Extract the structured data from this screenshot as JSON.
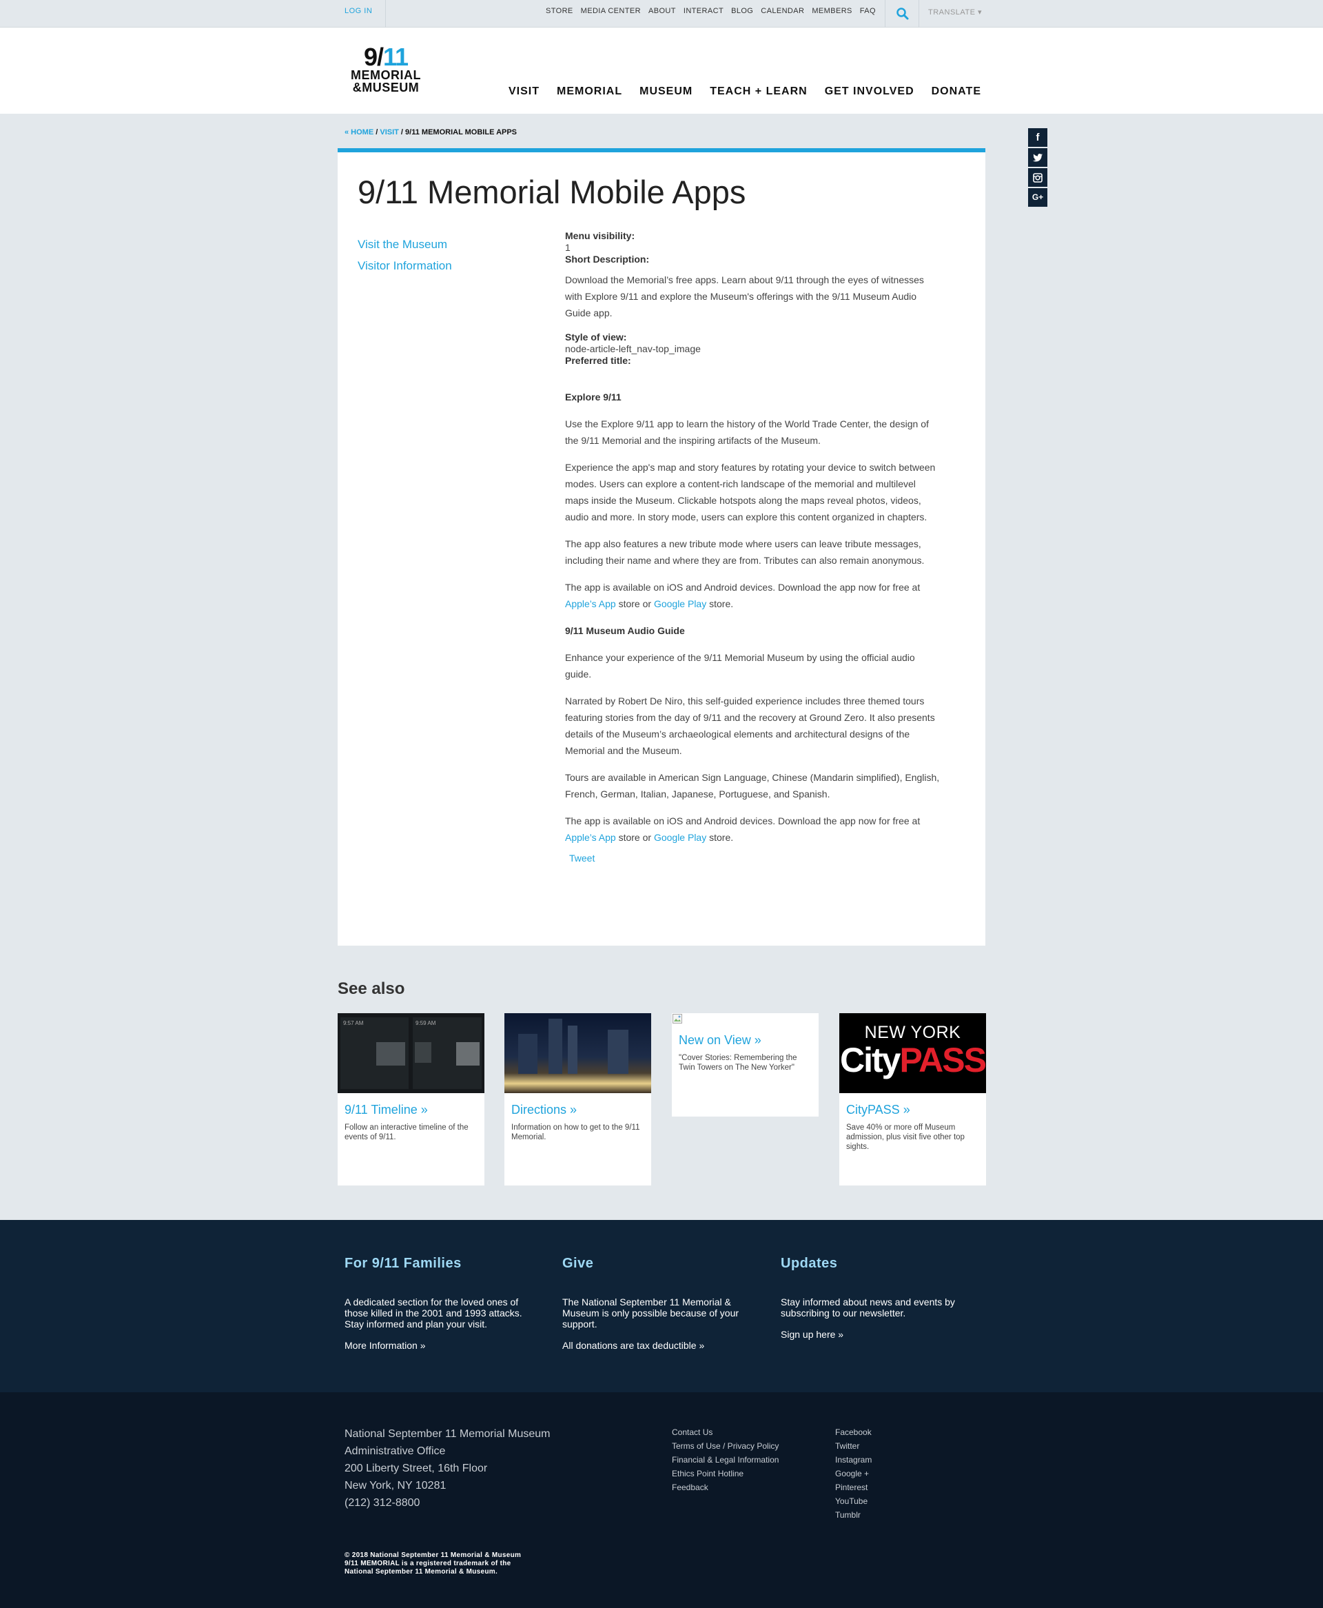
{
  "util": {
    "login": "LOG IN",
    "links": [
      "STORE",
      "MEDIA CENTER",
      "ABOUT",
      "INTERACT",
      "BLOG",
      "CALENDAR",
      "MEMBERS",
      "FAQ"
    ],
    "translate": "TRANSLATE ▾"
  },
  "logo": {
    "line1a": "9/",
    "line1b": "11",
    "line2": "MEMORIAL",
    "line3": "&MUSEUM"
  },
  "nav": [
    "VISIT",
    "MEMORIAL",
    "MUSEUM",
    "TEACH + LEARN",
    "GET INVOLVED",
    "DONATE"
  ],
  "breadcrumb": {
    "home": "« HOME",
    "visit": "VISIT",
    "current": "9/11 MEMORIAL MOBILE APPS",
    "sep": " / "
  },
  "social": [
    "f",
    "t",
    "i",
    "G+"
  ],
  "page": {
    "title": "9/11 Memorial Mobile Apps",
    "leftnav": [
      "Visit the Museum",
      "Visitor Information"
    ],
    "menu_visibility_label": "Menu visibility:",
    "menu_visibility_value": "1",
    "short_desc_label": "Short Description:",
    "short_desc": "Download the Memorial’s free apps. Learn about 9/11 through the eyes of witnesses with Explore 9/11 and explore the Museum's offerings with the 9/11 Museum Audio Guide app.",
    "style_label": "Style of view:",
    "style_value": "node-article-left_nav-top_image",
    "preferred_label": "Preferred title:",
    "explore_heading": "Explore 9/11",
    "p1": "Use the Explore 9/11 app to learn the history of the World Trade Center, the design of the 9/11 Memorial and the inspiring artifacts of the Museum.",
    "p2": "Experience the app's map and story features by rotating your device to switch between modes. Users can explore a content-rich landscape of the memorial and multilevel maps inside the Museum. Clickable hotspots along the maps reveal photos, videos, audio and more. In story mode, users can explore this content organized in chapters.",
    "p3": "The app also features a new tribute mode where users can leave tribute messages, including their name and where they are from. Tributes can also remain anonymous.",
    "avail_pre": "The app is available on iOS and Android devices. Download the app now for free at ",
    "apple": "Apple’s App",
    "mid": " store or ",
    "google": "Google Play",
    "post": " store.",
    "audio_heading": "9/11 Museum Audio Guide",
    "p4": "Enhance your experience of the 9/11 Memorial Museum by using the official audio guide.",
    "p5": "Narrated by Robert De Niro, this self-guided experience includes three themed tours featuring stories from the day of 9/11 and the recovery at Ground Zero. It also presents details of the Museum’s archaeological elements and architectural designs of the Memorial and the Museum.",
    "p6": "Tours are available in American Sign Language, Chinese (Mandarin simplified), English, French, German, Italian, Japanese, Portuguese, and Spanish.",
    "tweet": "Tweet"
  },
  "seealso": {
    "title": "See also",
    "tiles": [
      {
        "title": "9/11 Timeline »",
        "desc": "Follow an interactive timeline of the events of 9/11."
      },
      {
        "title": "Directions »",
        "desc": "Information on how to get to the 9/11 Memorial."
      },
      {
        "title": "New on View »",
        "desc": "\"Cover Stories: Remembering the Twin Towers on The New Yorker\""
      },
      {
        "title": "CityPASS »",
        "desc": "Save 40% or more off Museum admission, plus visit five other top sights.",
        "img_top": "NEW YORK",
        "img_a": "City",
        "img_b": "PASS"
      }
    ],
    "timeline_times": [
      "9:57 AM",
      "9:59 AM"
    ]
  },
  "footer": {
    "families": {
      "title": "For 9/11 Families",
      "text": "A dedicated section for the loved ones of those killed in the 2001 and 1993 attacks. Stay informed and plan your visit.",
      "more": "More Information »"
    },
    "give": {
      "title": "Give",
      "text": "The National September 11 Memorial & Museum is only possible because of your support.",
      "more": "All donations are tax deductible »"
    },
    "updates": {
      "title": "Updates",
      "text": "Stay informed about news and events by subscribing to our newsletter.",
      "more": "Sign up here »"
    },
    "address": [
      "National September 11 Memorial Museum",
      "Administrative Office",
      "200 Liberty Street, 16th Floor",
      "New York, NY 10281",
      "(212) 312-8800"
    ],
    "links1": [
      "Contact Us",
      "Terms of Use / Privacy Policy",
      "Financial & Legal Information",
      "Ethics Point Hotline",
      "Feedback"
    ],
    "links2": [
      "Facebook",
      "Twitter",
      "Instagram",
      "Google +",
      "Pinterest",
      "YouTube",
      "Tumblr"
    ],
    "copyright": [
      "© 2018 National September 11 Memorial & Museum",
      "9/11 MEMORIAL is a registered trademark of the",
      "National September 11 Memorial & Museum."
    ]
  },
  "colors": {
    "accent": "#1fa3dc",
    "navy": "#0f2337",
    "footer_dark": "#0b1726",
    "page_bg": "#e3e8ec",
    "citypass_red": "#e2202b"
  }
}
